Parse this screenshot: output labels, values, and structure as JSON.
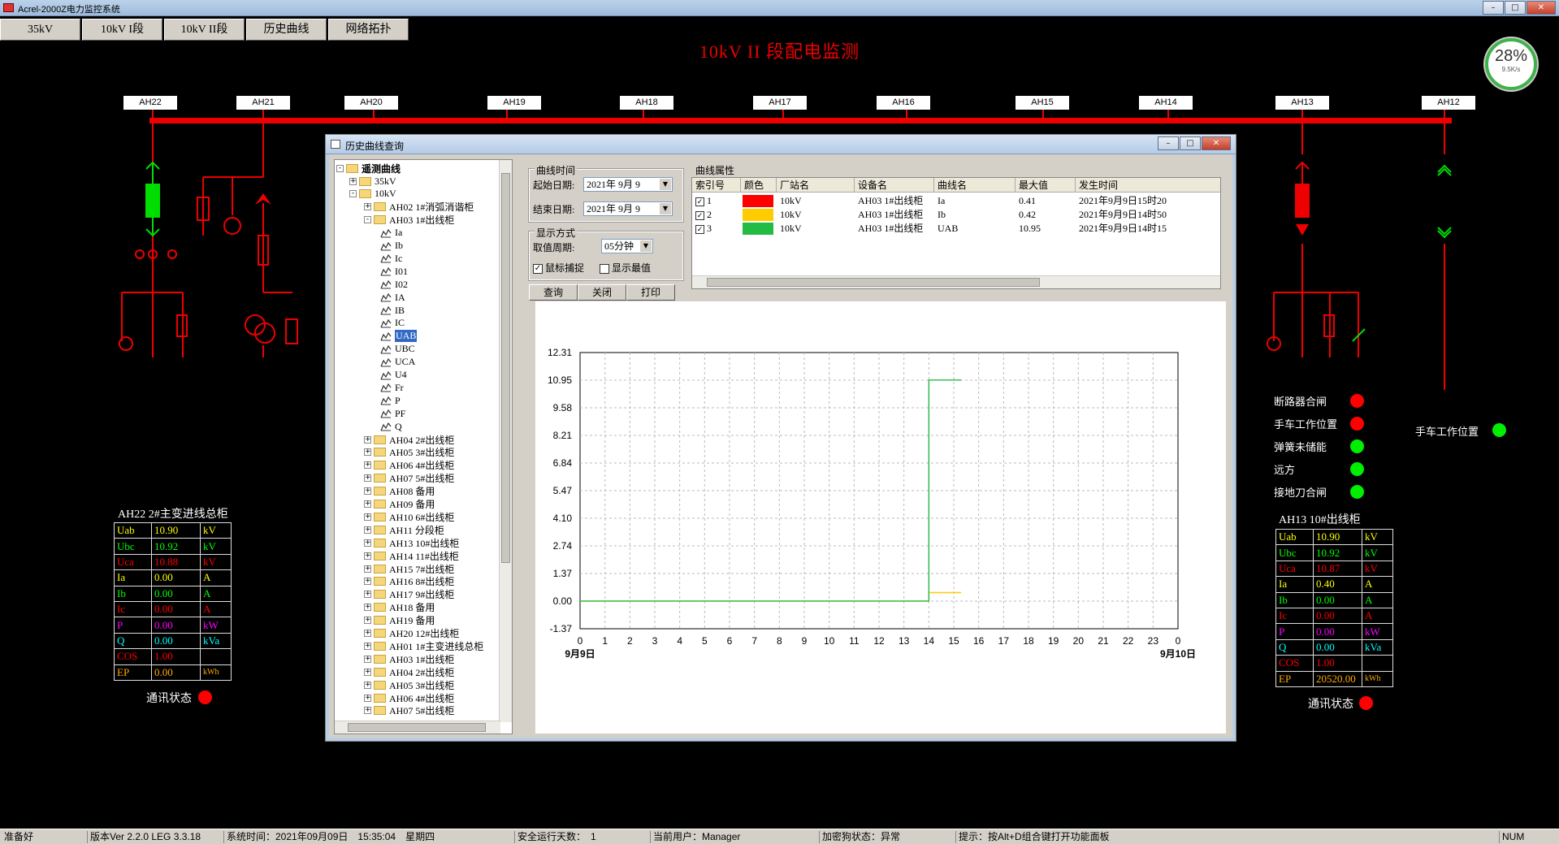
{
  "window": {
    "title": "Acrel-2000Z电力监控系统"
  },
  "tabs": [
    "35kV",
    "10kV I段",
    "10kV II段",
    "历史曲线",
    "网络拓扑"
  ],
  "page_title": "10kV II 段配电监测",
  "gauge": {
    "percent": "28%",
    "speed": "9.5K/s"
  },
  "cabinets": [
    "AH22",
    "AH21",
    "AH20",
    "AH19",
    "AH18",
    "AH17",
    "AH16",
    "AH15",
    "AH14",
    "AH13",
    "AH12"
  ],
  "left_panel": {
    "title": "AH22 2#主变进线总柜",
    "rows": [
      {
        "name": "Uab",
        "value": "10.90",
        "unit": "kV",
        "color": "#ffff00"
      },
      {
        "name": "Ubc",
        "value": "10.92",
        "unit": "kV",
        "color": "#00ff00"
      },
      {
        "name": "Uca",
        "value": "10.88",
        "unit": "kV",
        "color": "#ff0000"
      },
      {
        "name": "Ia",
        "value": "0.00",
        "unit": "A",
        "color": "#ffff00"
      },
      {
        "name": "Ib",
        "value": "0.00",
        "unit": "A",
        "color": "#00ff00"
      },
      {
        "name": "Ic",
        "value": "0.00",
        "unit": "A",
        "color": "#ff0000"
      },
      {
        "name": "P",
        "value": "0.00",
        "unit": "kW",
        "color": "#ff00ff"
      },
      {
        "name": "Q",
        "value": "0.00",
        "unit": "kVa",
        "color": "#00ffff"
      },
      {
        "name": "COS",
        "value": "1.00",
        "unit": "",
        "color": "#ff0000"
      },
      {
        "name": "EP",
        "value": "0.00",
        "unit": "kWh",
        "color": "#ffaa00"
      }
    ],
    "comm_label": "通讯状态"
  },
  "right_panel": {
    "title": "AH13 10#出线柜",
    "rows": [
      {
        "name": "Uab",
        "value": "10.90",
        "unit": "kV",
        "color": "#ffff00"
      },
      {
        "name": "Ubc",
        "value": "10.92",
        "unit": "kV",
        "color": "#00ff00"
      },
      {
        "name": "Uca",
        "value": "10.87",
        "unit": "kV",
        "color": "#ff0000"
      },
      {
        "name": "Ia",
        "value": "0.40",
        "unit": "A",
        "color": "#ffff00"
      },
      {
        "name": "Ib",
        "value": "0.00",
        "unit": "A",
        "color": "#00ff00"
      },
      {
        "name": "Ic",
        "value": "0.00",
        "unit": "A",
        "color": "#ff0000"
      },
      {
        "name": "P",
        "value": "0.00",
        "unit": "kW",
        "color": "#ff00ff"
      },
      {
        "name": "Q",
        "value": "0.00",
        "unit": "kVa",
        "color": "#00ffff"
      },
      {
        "name": "COS",
        "value": "1.00",
        "unit": "",
        "color": "#ff0000"
      },
      {
        "name": "EP",
        "value": "20520.00",
        "unit": "kWh",
        "color": "#ffaa00"
      }
    ],
    "comm_label": "通讯状态"
  },
  "signals": [
    {
      "label": "断路器合闸",
      "color": "#ff0000"
    },
    {
      "label": "手车工作位置",
      "color": "#ff0000"
    },
    {
      "label": "弹簧未储能",
      "color": "#00ee00"
    },
    {
      "label": "远方",
      "color": "#00ee00"
    },
    {
      "label": "接地刀合闸",
      "color": "#00ee00"
    }
  ],
  "ah12_signal": {
    "label": "手车工作位置",
    "color": "#00ee00"
  },
  "dialog": {
    "title": "历史曲线查询",
    "tree": {
      "root": "遥测曲线",
      "nodes": [
        {
          "label": "35kV",
          "level": 1,
          "type": "folder",
          "pm": "+"
        },
        {
          "label": "10kV",
          "level": 1,
          "type": "folder",
          "pm": "-"
        },
        {
          "label": "AH02 1#消弧消谐柜",
          "level": 2,
          "type": "folder",
          "pm": "+"
        },
        {
          "label": "AH03 1#出线柜",
          "level": 2,
          "type": "folder",
          "pm": "-"
        },
        {
          "label": "Ia",
          "level": 3,
          "type": "curve"
        },
        {
          "label": "Ib",
          "level": 3,
          "type": "curve"
        },
        {
          "label": "Ic",
          "level": 3,
          "type": "curve"
        },
        {
          "label": "I01",
          "level": 3,
          "type": "curve"
        },
        {
          "label": "I02",
          "level": 3,
          "type": "curve"
        },
        {
          "label": "IA",
          "level": 3,
          "type": "curve"
        },
        {
          "label": "IB",
          "level": 3,
          "type": "curve"
        },
        {
          "label": "IC",
          "level": 3,
          "type": "curve"
        },
        {
          "label": "UAB",
          "level": 3,
          "type": "curve",
          "selected": true
        },
        {
          "label": "UBC",
          "level": 3,
          "type": "curve"
        },
        {
          "label": "UCA",
          "level": 3,
          "type": "curve"
        },
        {
          "label": "U4",
          "level": 3,
          "type": "curve"
        },
        {
          "label": "Fr",
          "level": 3,
          "type": "curve"
        },
        {
          "label": "P",
          "level": 3,
          "type": "curve"
        },
        {
          "label": "PF",
          "level": 3,
          "type": "curve"
        },
        {
          "label": "Q",
          "level": 3,
          "type": "curve"
        },
        {
          "label": "AH04 2#出线柜",
          "level": 2,
          "type": "folder",
          "pm": "+"
        },
        {
          "label": "AH05 3#出线柜",
          "level": 2,
          "type": "folder",
          "pm": "+"
        },
        {
          "label": "AH06 4#出线柜",
          "level": 2,
          "type": "folder",
          "pm": "+"
        },
        {
          "label": "AH07 5#出线柜",
          "level": 2,
          "type": "folder",
          "pm": "+"
        },
        {
          "label": "AH08 备用",
          "level": 2,
          "type": "folder",
          "pm": "+"
        },
        {
          "label": "AH09 备用",
          "level": 2,
          "type": "folder",
          "pm": "+"
        },
        {
          "label": "AH10 6#出线柜",
          "level": 2,
          "type": "folder",
          "pm": "+"
        },
        {
          "label": "AH11 分段柜",
          "level": 2,
          "type": "folder",
          "pm": "+"
        },
        {
          "label": "AH13 10#出线柜",
          "level": 2,
          "type": "folder",
          "pm": "+"
        },
        {
          "label": "AH14 11#出线柜",
          "level": 2,
          "type": "folder",
          "pm": "+"
        },
        {
          "label": "AH15 7#出线柜",
          "level": 2,
          "type": "folder",
          "pm": "+"
        },
        {
          "label": "AH16 8#出线柜",
          "level": 2,
          "type": "folder",
          "pm": "+"
        },
        {
          "label": "AH17 9#出线柜",
          "level": 2,
          "type": "folder",
          "pm": "+"
        },
        {
          "label": "AH18 备用",
          "level": 2,
          "type": "folder",
          "pm": "+"
        },
        {
          "label": "AH19 备用",
          "level": 2,
          "type": "folder",
          "pm": "+"
        },
        {
          "label": "AH20 12#出线柜",
          "level": 2,
          "type": "folder",
          "pm": "+"
        },
        {
          "label": "AH01 1#主变进线总柜",
          "level": 2,
          "type": "folder",
          "pm": "+"
        },
        {
          "label": "AH03 1#出线柜",
          "level": 2,
          "type": "folder",
          "pm": "+"
        },
        {
          "label": "AH04 2#出线柜",
          "level": 2,
          "type": "folder",
          "pm": "+"
        },
        {
          "label": "AH05 3#出线柜",
          "level": 2,
          "type": "folder",
          "pm": "+"
        },
        {
          "label": "AH06 4#出线柜",
          "level": 2,
          "type": "folder",
          "pm": "+"
        },
        {
          "label": "AH07 5#出线柜",
          "level": 2,
          "type": "folder",
          "pm": "+"
        }
      ]
    },
    "time_group": {
      "title": "曲线时间",
      "start_label": "起始日期:",
      "start_value": "2021年 9月 9",
      "end_label": "结束日期:",
      "end_value": "2021年 9月 9"
    },
    "display_group": {
      "title": "显示方式",
      "period_label": "取值周期:",
      "period_value": "05分钟",
      "cursor_label": "鼠标捕捉",
      "cursor_checked": true,
      "show_max_label": "显示最值",
      "show_max_checked": false
    },
    "buttons": {
      "query": "查询",
      "close": "关闭",
      "print": "打印"
    },
    "props": {
      "title": "曲线属性",
      "headers": [
        "索引号",
        "颜色",
        "厂站名",
        "设备名",
        "曲线名",
        "最大值",
        "发生时间"
      ],
      "rows": [
        {
          "index": "1",
          "color": "#ff0000",
          "station": "10kV",
          "device": "AH03 1#出线柜",
          "curve": "Ia",
          "max": "0.41",
          "time": "2021年9月9日15时20"
        },
        {
          "index": "2",
          "color": "#ffcc00",
          "station": "10kV",
          "device": "AH03 1#出线柜",
          "curve": "Ib",
          "max": "0.42",
          "time": "2021年9月9日14时50"
        },
        {
          "index": "3",
          "color": "#22bb44",
          "station": "10kV",
          "device": "AH03 1#出线柜",
          "curve": "UAB",
          "max": "10.95",
          "time": "2021年9月9日14时15"
        }
      ]
    }
  },
  "chart_data": {
    "type": "line",
    "ylim": [
      -1.37,
      12.31
    ],
    "y_ticks": [
      "12.31",
      "10.95",
      "9.58",
      "8.21",
      "6.84",
      "5.47",
      "4.10",
      "2.74",
      "1.37",
      "0.00",
      "-1.37"
    ],
    "x_ticks": [
      "0",
      "1",
      "2",
      "3",
      "4",
      "5",
      "6",
      "7",
      "8",
      "9",
      "10",
      "11",
      "12",
      "13",
      "14",
      "15",
      "16",
      "17",
      "18",
      "19",
      "20",
      "21",
      "22",
      "23",
      "0"
    ],
    "x_start_label": "9月9日",
    "x_end_label": "9月10日",
    "xlim": [
      0,
      24
    ],
    "grid": true,
    "series": [
      {
        "color": "#ffcc00",
        "x": [
          0,
          14.0,
          14.0,
          15.3
        ],
        "y": [
          0.0,
          0.0,
          0.42,
          0.42
        ]
      },
      {
        "color": "#22bb44",
        "x": [
          0,
          14.0,
          14.0,
          15.3
        ],
        "y": [
          0.0,
          0.0,
          10.95,
          10.95
        ]
      }
    ]
  },
  "statusbar": {
    "ready": "准备好",
    "version": "版本Ver 2.2.0 LEG 3.3.18",
    "systime": "系统时间：2021年09月09日　15:35:04　星期四",
    "safe_days": "安全运行天数：　1",
    "user": "当前用户：Manager",
    "dongle": "加密狗状态：异常",
    "hint": "提示：按Alt+D组合键打开功能面板",
    "num": "NUM"
  }
}
